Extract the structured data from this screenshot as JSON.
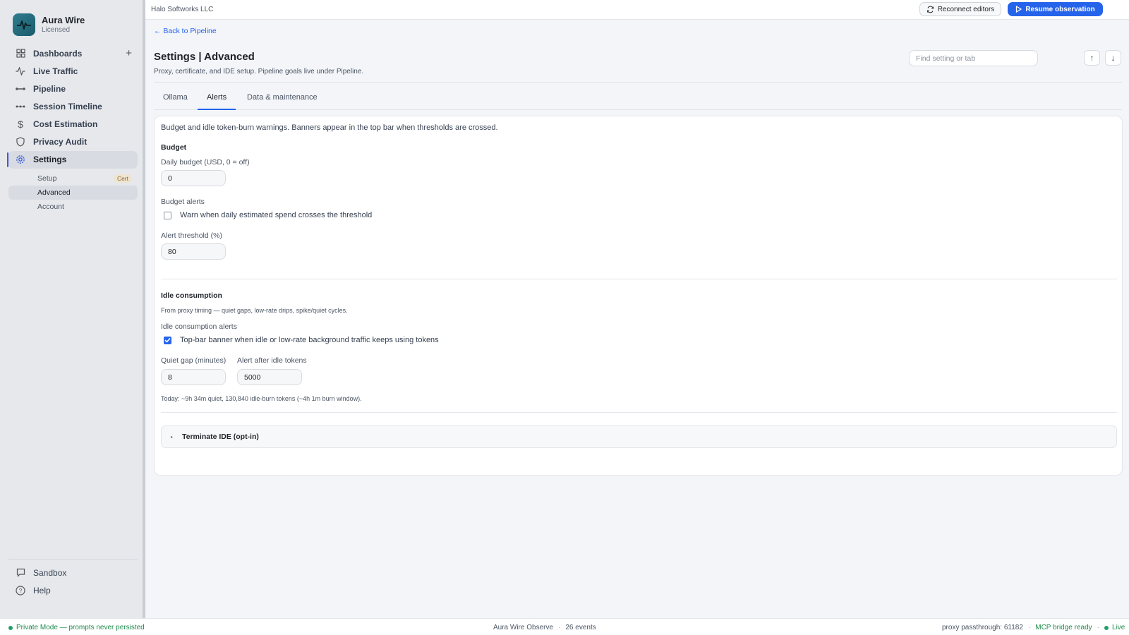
{
  "brand": {
    "name": "Aura Wire",
    "license": "Licensed"
  },
  "sidebar": {
    "items": [
      {
        "label": "Dashboards",
        "icon": "grid-icon"
      },
      {
        "label": "Live Traffic",
        "icon": "activity-icon"
      },
      {
        "label": "Pipeline",
        "icon": "pipeline-icon"
      },
      {
        "label": "Session Timeline",
        "icon": "timeline-icon"
      },
      {
        "label": "Cost Estimation",
        "icon": "dollar-icon"
      },
      {
        "label": "Privacy Audit",
        "icon": "shield-icon"
      },
      {
        "label": "Settings",
        "icon": "gear-icon"
      }
    ],
    "settings_sub": [
      {
        "label": "Setup",
        "badge": "Cert"
      },
      {
        "label": "Advanced"
      },
      {
        "label": "Account"
      }
    ],
    "bottom": [
      {
        "label": "Sandbox",
        "icon": "chat-icon"
      },
      {
        "label": "Help",
        "icon": "help-icon"
      }
    ]
  },
  "topbar": {
    "org": "Halo Softworks LLC",
    "reconnect_label": "Reconnect editors",
    "resume_label": "Resume observation"
  },
  "page": {
    "back": "← Back to Pipeline",
    "title": "Settings | Advanced",
    "subtitle": "Proxy, certificate, and IDE setup. Pipeline goals live under Pipeline.",
    "search_placeholder": "Find setting or tab",
    "up": "↑",
    "down": "↓"
  },
  "tabs": [
    {
      "label": "Ollama"
    },
    {
      "label": "Alerts",
      "active": true
    },
    {
      "label": "Data & maintenance"
    }
  ],
  "alerts": {
    "intro": "Budget and idle token-burn warnings. Banners appear in the top bar when thresholds are crossed.",
    "budget": {
      "heading": "Budget",
      "daily_label": "Daily budget (USD, 0 = off)",
      "daily_value": "0",
      "alerts_label": "Budget alerts",
      "warn_text": "Warn when daily estimated spend crosses the threshold",
      "warn_checked": false,
      "threshold_label": "Alert threshold (%)",
      "threshold_value": "80"
    },
    "idle": {
      "heading": "Idle consumption",
      "desc": "From proxy timing — quiet gaps, low-rate drips, spike/quiet cycles.",
      "alerts_label": "Idle consumption alerts",
      "banner_text": "Top-bar banner when idle or low-rate background traffic keeps using tokens",
      "banner_checked": true,
      "gap_label": "Quiet gap (minutes)",
      "gap_value": "8",
      "tokens_label": "Alert after idle tokens",
      "tokens_value": "5000",
      "today": "Today: ~9h 34m quiet, 130,840 idle-burn tokens (~4h 1m burn window)."
    },
    "terminate_label": "Terminate IDE (opt-in)"
  },
  "status": {
    "private_mode": "Private Mode — prompts never persisted",
    "app": "Aura Wire Observe",
    "events": "26 events",
    "proxy": "proxy passthrough: 61182",
    "mcp": "MCP bridge ready",
    "live": "Live"
  },
  "colors": {
    "accent": "#2563eb",
    "ok": "#22a06b",
    "brand": "#1c5b6b"
  }
}
